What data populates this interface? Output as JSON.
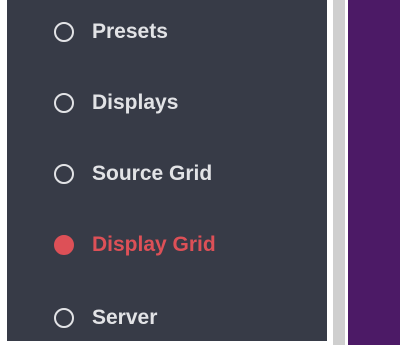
{
  "sidebar": {
    "items": [
      {
        "label": "Presets",
        "state": "unselected"
      },
      {
        "label": "Displays",
        "state": "unselected"
      },
      {
        "label": "Source Grid",
        "state": "unselected"
      },
      {
        "label": "Display Grid",
        "state": "selected"
      },
      {
        "label": "Server",
        "state": "unselected"
      }
    ],
    "background_color": "#373b47",
    "text_color": "#e2e3e6",
    "active_color": "#dd5057"
  },
  "content_panel": {
    "background_color": "#4c1a66"
  },
  "icons": {
    "unselected": "radio-unselected-icon",
    "selected": "radio-selected-icon"
  }
}
